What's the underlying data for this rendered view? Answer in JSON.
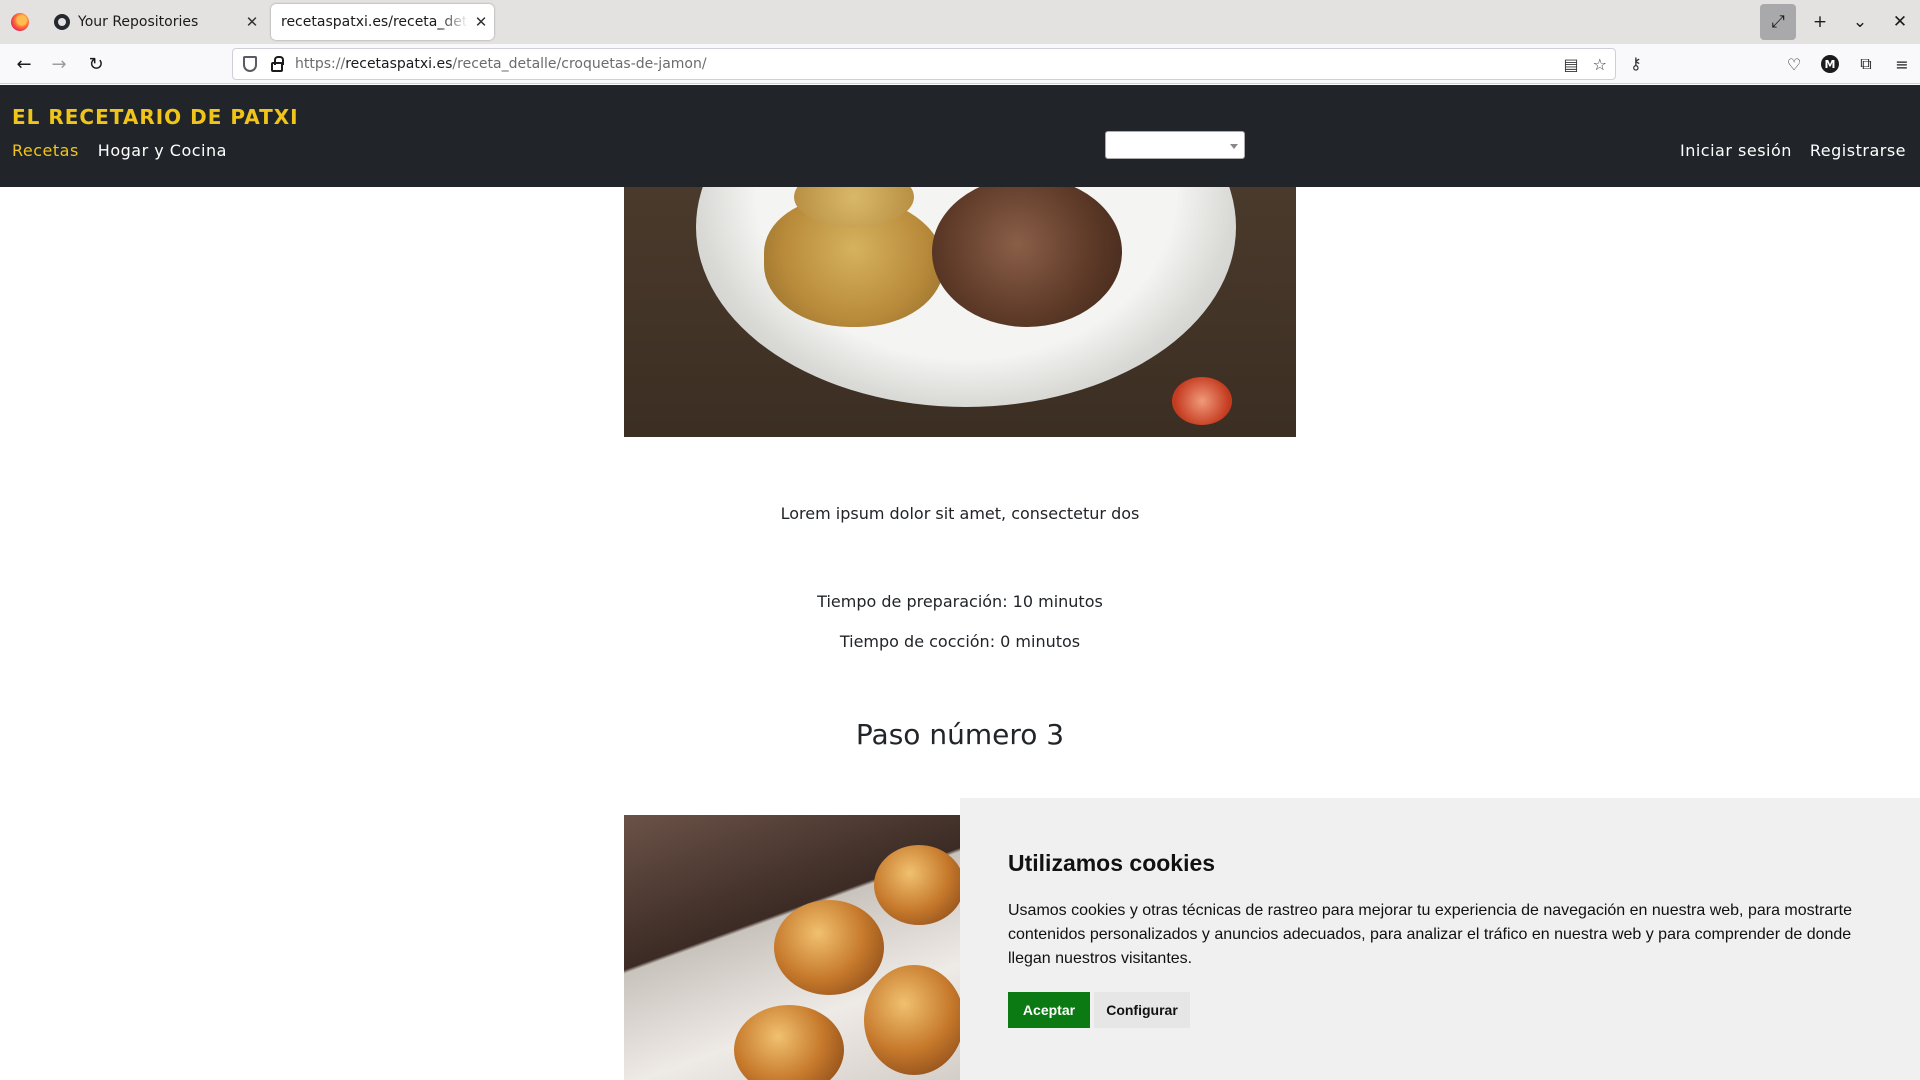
{
  "browser": {
    "tabs": [
      {
        "title": "Your Repositories"
      },
      {
        "title": "recetaspatxi.es/receta_detalle/croquetas-de-jamon/"
      }
    ],
    "url_prefix": "https://",
    "url_domain": "recetaspatxi.es",
    "url_path": "/receta_detalle/croquetas-de-jamon/",
    "avatar_letter": "M"
  },
  "site": {
    "brand": "EL RECETARIO DE PATXI",
    "nav": [
      {
        "label": "Recetas",
        "active": true
      },
      {
        "label": "Hogar y Cocina",
        "active": false
      }
    ],
    "select_value": "",
    "auth": {
      "login": "Iniciar sesión",
      "register": "Registrarse"
    },
    "accent_color": "#f0c419",
    "header_color": "#212529"
  },
  "content": {
    "description": "Lorem ipsum dolor sit amet, consectetur dos",
    "prep_time": "Tiempo de preparación: 10 minutos",
    "cook_time": "Tiempo de cocción: 0 minutos",
    "step_title": "Paso número 3"
  },
  "cookie_banner": {
    "title": "Utilizamos cookies",
    "text": "Usamos cookies y otras técnicas de rastreo para mejorar tu experiencia de navegación en nuestra web, para mostrarte contenidos personalizados y anuncios adecuados, para analizar el tráfico en nuestra web y para comprender de donde llegan nuestros visitantes.",
    "accept_label": "Aceptar",
    "configure_label": "Configurar",
    "accept_color": "#0b7a12"
  }
}
